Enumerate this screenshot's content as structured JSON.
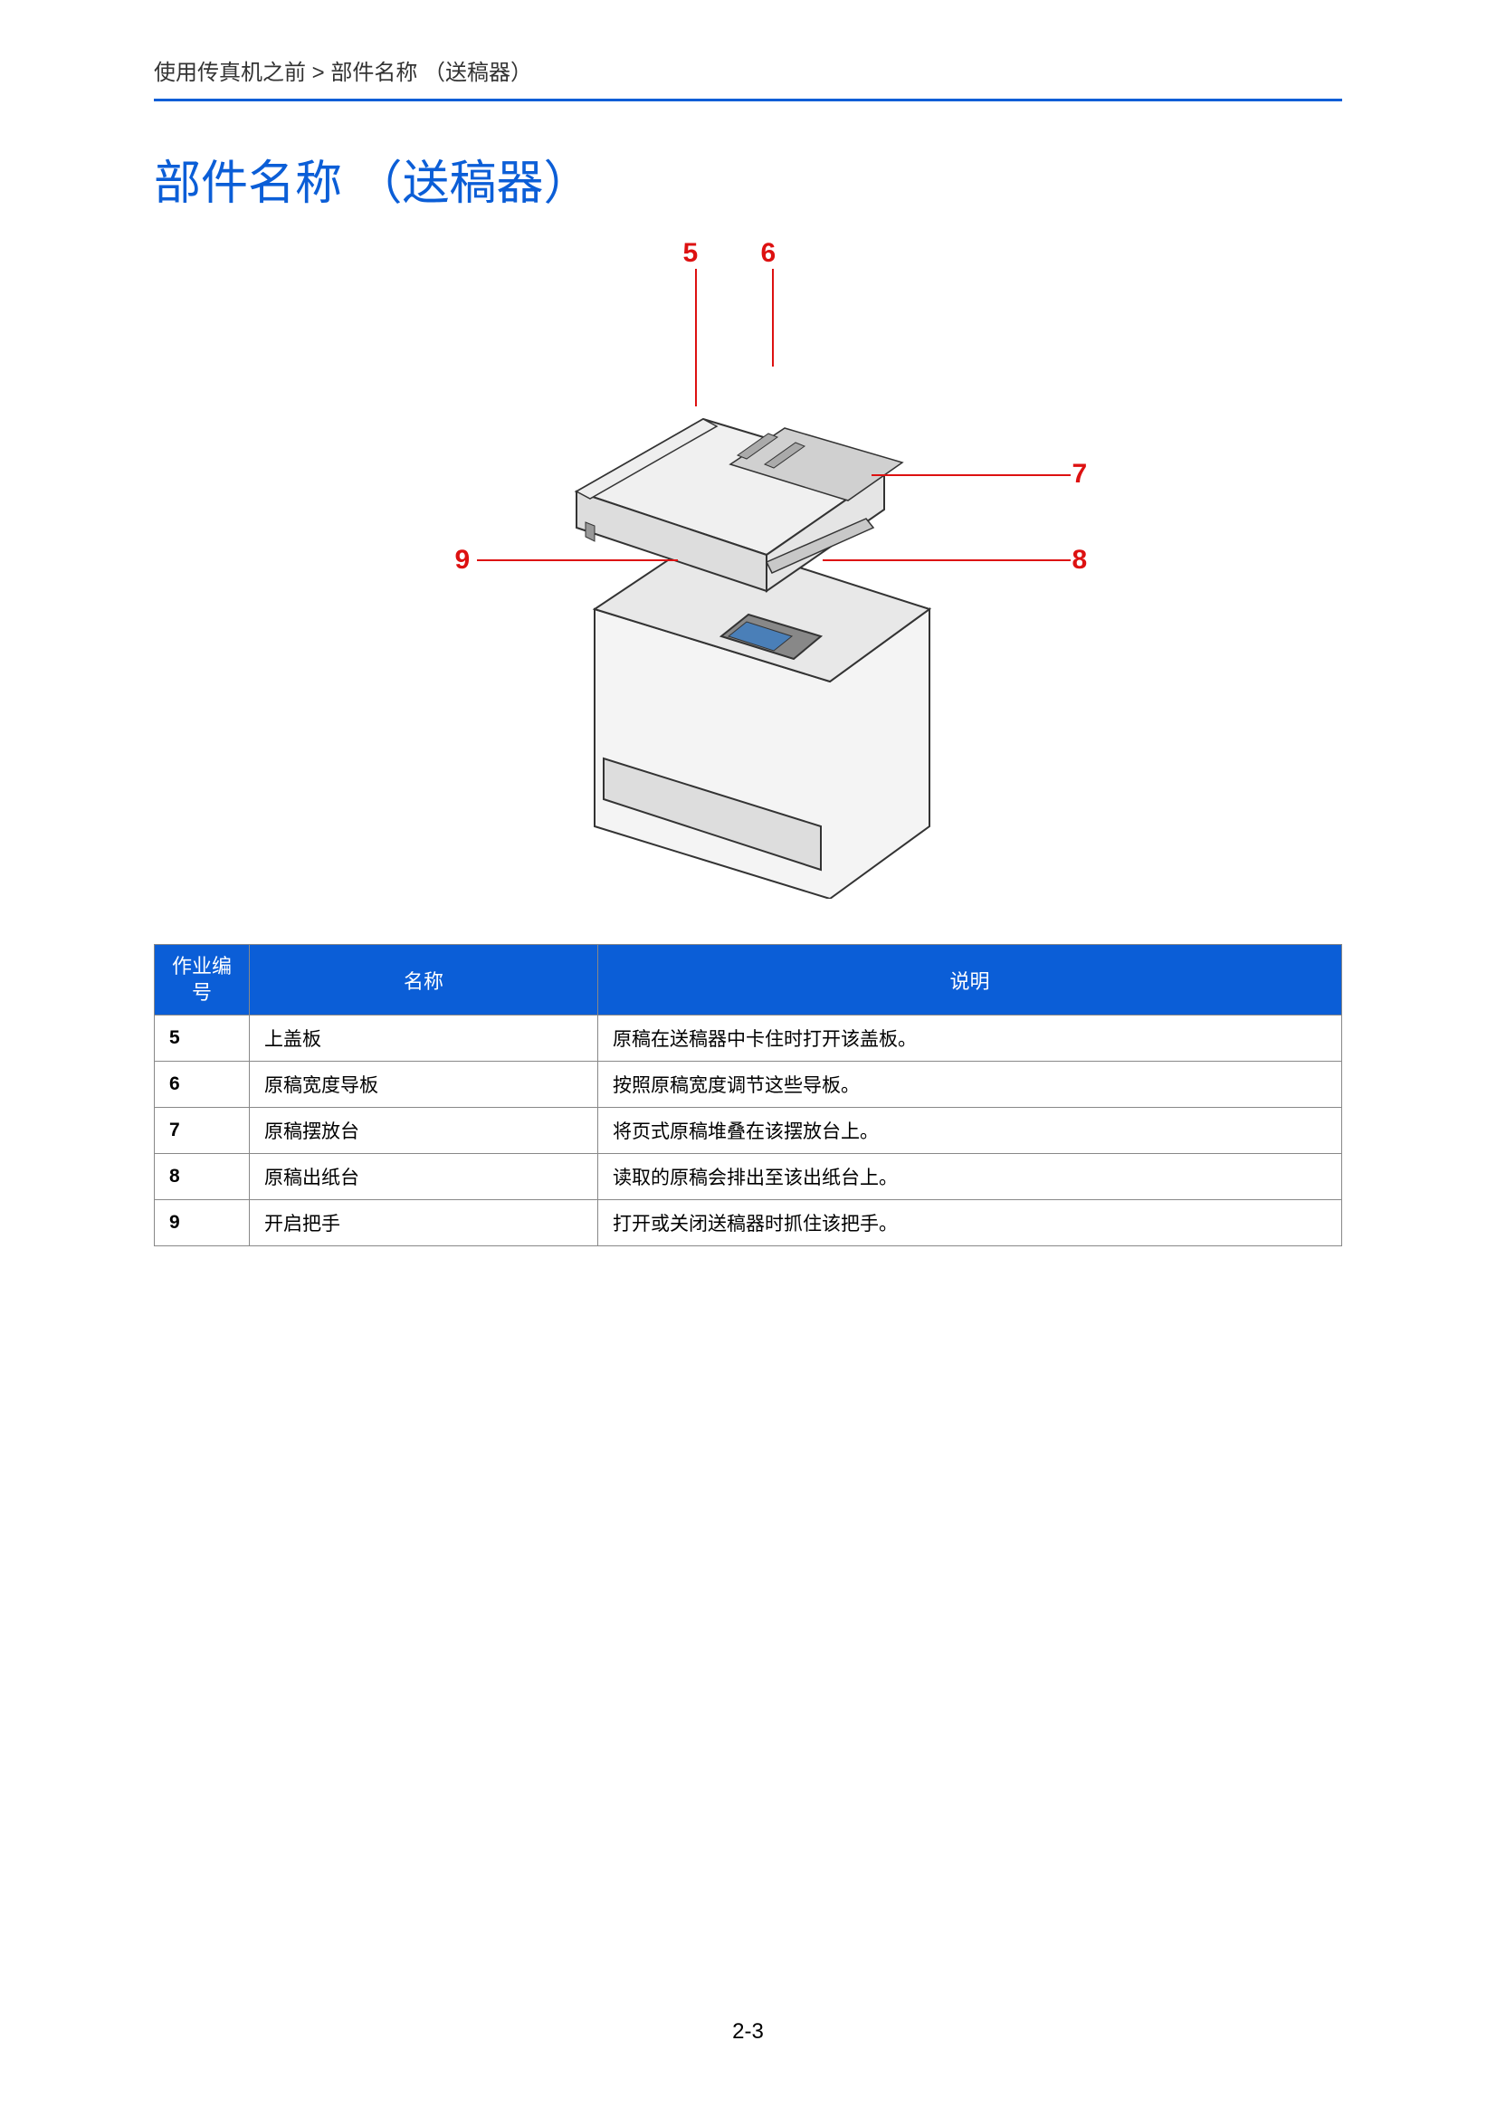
{
  "breadcrumb": "使用传真机之前 > 部件名称 （送稿器）",
  "title": "部件名称 （送稿器）",
  "callouts": {
    "c5": "5",
    "c6": "6",
    "c7": "7",
    "c8": "8",
    "c9": "9"
  },
  "table": {
    "headers": {
      "no": "作业编号",
      "name": "名称",
      "desc": "说明"
    },
    "rows": [
      {
        "no": "5",
        "name": "上盖板",
        "desc": "原稿在送稿器中卡住时打开该盖板。"
      },
      {
        "no": "6",
        "name": "原稿宽度导板",
        "desc": "按照原稿宽度调节这些导板。"
      },
      {
        "no": "7",
        "name": "原稿摆放台",
        "desc": "将页式原稿堆叠在该摆放台上。"
      },
      {
        "no": "8",
        "name": "原稿出纸台",
        "desc": "读取的原稿会排出至该出纸台上。"
      },
      {
        "no": "9",
        "name": "开启把手",
        "desc": "打开或关闭送稿器时抓住该把手。"
      }
    ]
  },
  "page_number": "2-3"
}
